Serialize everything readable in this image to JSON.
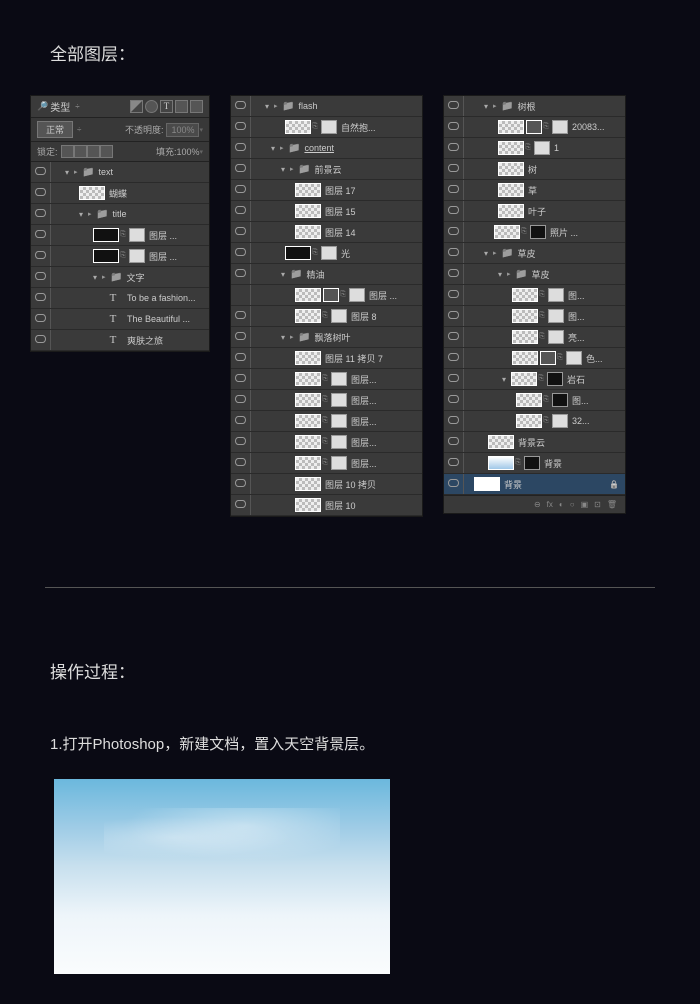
{
  "section1_title": "全部图层：",
  "section2_title": "操作过程：",
  "step1": "1.打开Photoshop，新建文档，置入天空背景层。",
  "panel1": {
    "kind": "类型",
    "normal": "正常",
    "opacity_lbl": "不透明度:",
    "opacity_val": "100%",
    "lock_lbl": "锁定:",
    "fill_lbl": "填充:",
    "fill_val": "100%",
    "rows": [
      {
        "indent": 14,
        "tri": "▾",
        "fold": "▸",
        "type": "folder",
        "name": "text"
      },
      {
        "indent": 28,
        "type": "thumb",
        "thumbCls": "chk",
        "name": "蝴蝶"
      },
      {
        "indent": 28,
        "tri": "▾",
        "fold": "▸",
        "type": "folder",
        "name": "title"
      },
      {
        "indent": 42,
        "type": "thumb-mask",
        "thumbCls": "dark",
        "name": "图层 ..."
      },
      {
        "indent": 42,
        "type": "thumb-mask",
        "thumbCls": "dark",
        "name": "图层 ..."
      },
      {
        "indent": 42,
        "tri": "▾",
        "fold": "▸",
        "type": "folder",
        "name": "文字"
      },
      {
        "indent": 52,
        "type": "text",
        "name": "To be a fashion..."
      },
      {
        "indent": 52,
        "type": "text",
        "name": "The Beautiful ..."
      },
      {
        "indent": 52,
        "type": "text",
        "name": "爽肤之旅"
      }
    ]
  },
  "panel2": {
    "rows": [
      {
        "indent": 14,
        "tri": "▾",
        "fold": "▸",
        "type": "folder",
        "name": "flash"
      },
      {
        "indent": 34,
        "type": "thumb-mask",
        "thumbCls": "chk",
        "name": "自然抱..."
      },
      {
        "indent": 20,
        "tri": "▾",
        "fold": "▸",
        "type": "folder",
        "name": "content",
        "underline": true
      },
      {
        "indent": 30,
        "tri": "▾",
        "fold": "▸",
        "type": "folder",
        "name": "前景云"
      },
      {
        "indent": 44,
        "type": "thumb",
        "thumbCls": "chk",
        "name": "图层 17"
      },
      {
        "indent": 44,
        "type": "thumb",
        "thumbCls": "chk",
        "name": "图层 15"
      },
      {
        "indent": 44,
        "type": "thumb",
        "thumbCls": "chk",
        "name": "图层 14"
      },
      {
        "indent": 34,
        "type": "thumb-mask",
        "thumbCls": "dark",
        "name": "光"
      },
      {
        "indent": 30,
        "tri": "▾",
        "type": "folder",
        "name": "精油"
      },
      {
        "indent": 44,
        "type": "thumb-adjmask",
        "thumbCls": "chk",
        "name": "图层 ...",
        "novis": true
      },
      {
        "indent": 44,
        "type": "thumb-mask",
        "thumbCls": "chk",
        "name": "图层 8"
      },
      {
        "indent": 30,
        "tri": "▾",
        "fold": "▸",
        "type": "folder",
        "name": "飘落树叶"
      },
      {
        "indent": 44,
        "type": "thumb",
        "thumbCls": "chk",
        "name": "图层 11 拷贝 7"
      },
      {
        "indent": 44,
        "type": "thumb-mask",
        "thumbCls": "chk",
        "name": "图层..."
      },
      {
        "indent": 44,
        "type": "thumb-mask",
        "thumbCls": "chk",
        "name": "图层..."
      },
      {
        "indent": 44,
        "type": "thumb-mask",
        "thumbCls": "chk",
        "name": "图层..."
      },
      {
        "indent": 44,
        "type": "thumb-mask",
        "thumbCls": "chk",
        "name": "图层..."
      },
      {
        "indent": 44,
        "type": "thumb-mask",
        "thumbCls": "chk",
        "name": "图层..."
      },
      {
        "indent": 44,
        "type": "thumb",
        "thumbCls": "chk",
        "name": "图层 10 拷贝"
      },
      {
        "indent": 44,
        "type": "thumb",
        "thumbCls": "chk",
        "name": "图层 10"
      }
    ]
  },
  "panel3": {
    "rows": [
      {
        "indent": 20,
        "tri": "▾",
        "fold": "▸",
        "type": "folder",
        "name": "树根"
      },
      {
        "indent": 34,
        "type": "thumb-adj-mask",
        "thumbCls": "chk",
        "name": "20083..."
      },
      {
        "indent": 34,
        "type": "thumb-mask",
        "thumbCls": "chk",
        "maskdot": ".",
        "name": "1"
      },
      {
        "indent": 34,
        "type": "thumb",
        "thumbCls": "chk",
        "name": "树"
      },
      {
        "indent": 34,
        "type": "thumb",
        "thumbCls": "chk",
        "name": "草"
      },
      {
        "indent": 34,
        "type": "thumb",
        "thumbCls": "chk",
        "name": "叶子"
      },
      {
        "indent": 30,
        "type": "thumb-mask",
        "thumbCls": "chk",
        "maskCls": "dark",
        "name": "照片 ..."
      },
      {
        "indent": 20,
        "tri": "▾",
        "fold": "▸",
        "type": "folder",
        "name": "草皮"
      },
      {
        "indent": 34,
        "tri": "▾",
        "fold": "▸",
        "type": "folder",
        "name": "草皮"
      },
      {
        "indent": 48,
        "type": "thumb-mask",
        "thumbCls": "chk",
        "name": "图..."
      },
      {
        "indent": 48,
        "type": "thumb-mask",
        "thumbCls": "chk",
        "name": "图..."
      },
      {
        "indent": 48,
        "type": "thumb-mask",
        "thumbCls": "chk",
        "name": "亮..."
      },
      {
        "indent": 48,
        "type": "thumb-adj-mask",
        "thumbCls": "chk",
        "name": "色..."
      },
      {
        "indent": 38,
        "tri": "▾",
        "type": "thumb-mask",
        "thumbCls": "chk",
        "maskCls": "dark",
        "name": "岩石"
      },
      {
        "indent": 52,
        "type": "thumb-mask",
        "thumbCls": "chk",
        "maskCls": "dark",
        "name": "图..."
      },
      {
        "indent": 52,
        "type": "thumb-mask",
        "thumbCls": "chk",
        "name": "32..."
      },
      {
        "indent": 24,
        "type": "thumb",
        "thumbCls": "chk",
        "name": "背景云"
      },
      {
        "indent": 24,
        "type": "thumb-mask",
        "thumbCls": "sky",
        "maskCls": "dark",
        "name": "背景"
      },
      {
        "indent": 10,
        "sel": true,
        "type": "thumb",
        "thumbCls": "white",
        "name": "背景",
        "lock": true
      }
    ],
    "footer": [
      "⊖",
      "fx",
      "◐",
      "○",
      "▣",
      "⊡",
      "🗑"
    ]
  }
}
